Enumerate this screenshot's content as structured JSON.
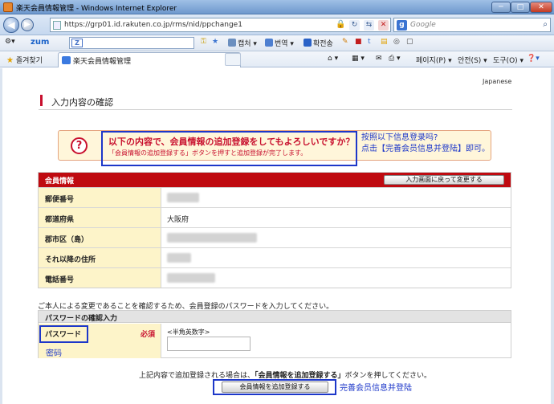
{
  "window": {
    "title": "楽天会員情報管理 - Windows Internet Explorer",
    "buttons": {
      "minimize": "─",
      "maximize": "□",
      "close": "✕"
    }
  },
  "addressbar": {
    "url": "https://grp01.id.rakuten.co.jp/rms/nid/ppchange1",
    "search_placeholder": "Google",
    "back_icon": "back-arrow-icon",
    "forward_icon": "forward-arrow-icon"
  },
  "toolbar": {
    "brand": "zum",
    "items": [
      "캡처 ▾",
      "번역 ▾",
      "확전송",
      "페이지(P) ▾",
      "안전(S) ▾",
      "도구(O) ▾"
    ]
  },
  "favorites": {
    "label": "즐겨찾기",
    "tab_title": "楽天会員情報管理"
  },
  "page": {
    "language": "Japanese",
    "title": "入力内容の確認",
    "alert": {
      "icon": "?",
      "message": "以下の内容で、会員情報の追加登録をしてもよろしいですか？",
      "sub": "「会員情報の追加登録する」ボタンを押すと追加登録が完了します。"
    },
    "annotation_cn_1a": "按照以下信息登录吗?",
    "annotation_cn_1b": "点击【完善会员信息并登陆】即可。",
    "member_info": {
      "header": "会員情報",
      "back_button": "入力画面に戻って変更する",
      "rows": [
        {
          "label": "郵便番号",
          "value": ""
        },
        {
          "label": "都道府県",
          "value": "大阪府"
        },
        {
          "label": "郡市区（島）",
          "value": ""
        },
        {
          "label": "それ以降の住所",
          "value": ""
        },
        {
          "label": "電話番号",
          "value": ""
        }
      ]
    },
    "instruction": "ご本人による変更であることを確認するため、会員登録のパスワードを入力してください。",
    "password": {
      "header": "パスワードの確認入力",
      "label": "パスワード",
      "required": "必須",
      "hint": "<半角英数字>",
      "annotation_cn": "密码"
    },
    "bottom_note_pre": "上記内容で追加登録される場合は、",
    "bottom_note_bold": "「会員情報を追加登録する」",
    "bottom_note_post": "ボタンを押してください。",
    "submit_button": "会員情報を追加登録する",
    "annotation_cn_3": "完善会员信息并登陆"
  }
}
